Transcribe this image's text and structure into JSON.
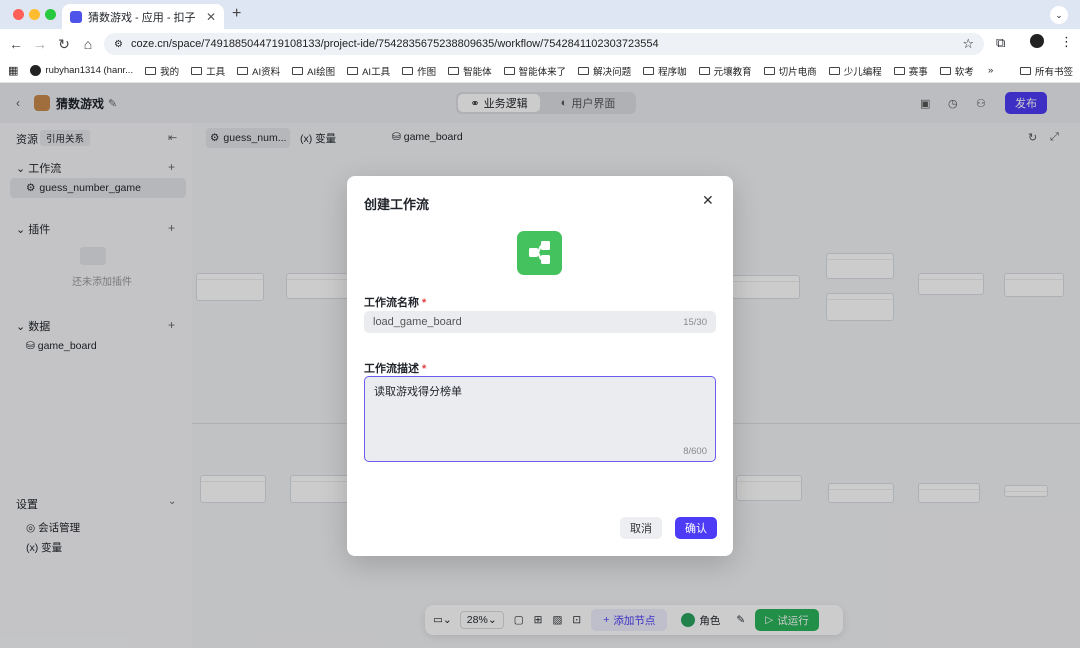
{
  "browser": {
    "tab_title": "猜数游戏 - 应用 - 扣子",
    "url": "coze.cn/space/7491885044719108133/project-ide/7542835675238809635/workflow/7542841102303723554",
    "bookmarks": [
      "rubyhan1314 (hanr...",
      "我的",
      "工具",
      "AI资料",
      "AI绘图",
      "AI工具",
      "作图",
      "智能体",
      "智能体来了",
      "解决问题",
      "程序咖",
      "元壤教育",
      "切片电商",
      "少儿编程",
      "赛事",
      "软考"
    ],
    "all_bookmarks": "所有书签",
    "more": "»"
  },
  "app": {
    "title": "猜数游戏",
    "tabs": [
      "业务逻辑",
      "用户界面"
    ],
    "publish": "发布"
  },
  "sidebar": {
    "resources": "资源",
    "refs": "引用关系",
    "workflow_section": "工作流",
    "workflow_item": "guess_number_game",
    "plugin_section": "插件",
    "plugin_empty": "还未添加插件",
    "data_section": "数据",
    "data_item": "game_board",
    "settings": "设置",
    "session": "会话管理",
    "variables": "变量"
  },
  "editor_tabs": [
    "guess_num...",
    "变量",
    "game_board"
  ],
  "toolbar": {
    "zoom": "28%",
    "add_node": "添加节点",
    "role": "角色",
    "run": "试运行"
  },
  "modal": {
    "title": "创建工作流",
    "name_label": "工作流名称",
    "name_value": "load_game_board",
    "name_count": "15/30",
    "desc_label": "工作流描述",
    "desc_value": "读取游戏得分榜单",
    "desc_count": "8/600",
    "cancel": "取消",
    "confirm": "确认"
  },
  "colors": {
    "accent": "#4d3bf5",
    "icon_green": "#44c25d"
  }
}
